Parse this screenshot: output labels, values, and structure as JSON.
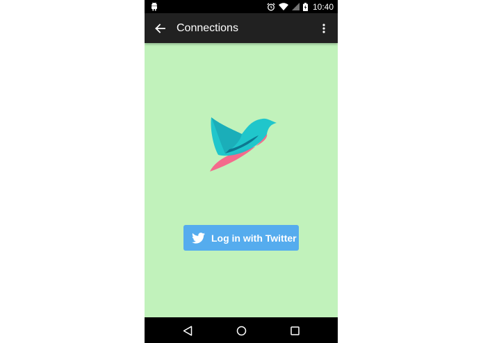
{
  "status_bar": {
    "time": "10:40",
    "icons": [
      "android-icon",
      "alarm-icon",
      "wifi-icon",
      "signal-icon",
      "battery-charging-icon"
    ]
  },
  "app_bar": {
    "title": "Connections",
    "back_icon": "arrow-back-icon",
    "menu_icon": "more-vert-icon"
  },
  "main": {
    "logo": "bird-logo",
    "login_button_label": "Log in with Twitter",
    "login_button_icon": "twitter-bird-icon"
  },
  "nav_bar": {
    "icons": [
      "back-triangle-icon",
      "home-circle-icon",
      "recents-square-icon"
    ]
  },
  "colors": {
    "background": "#c1f2bb",
    "app_bar": "#212121",
    "twitter_button": "#55acee",
    "logo_teal": "#12c2cc",
    "logo_dark": "#0b6f8a",
    "logo_pink": "#f46b8c"
  }
}
